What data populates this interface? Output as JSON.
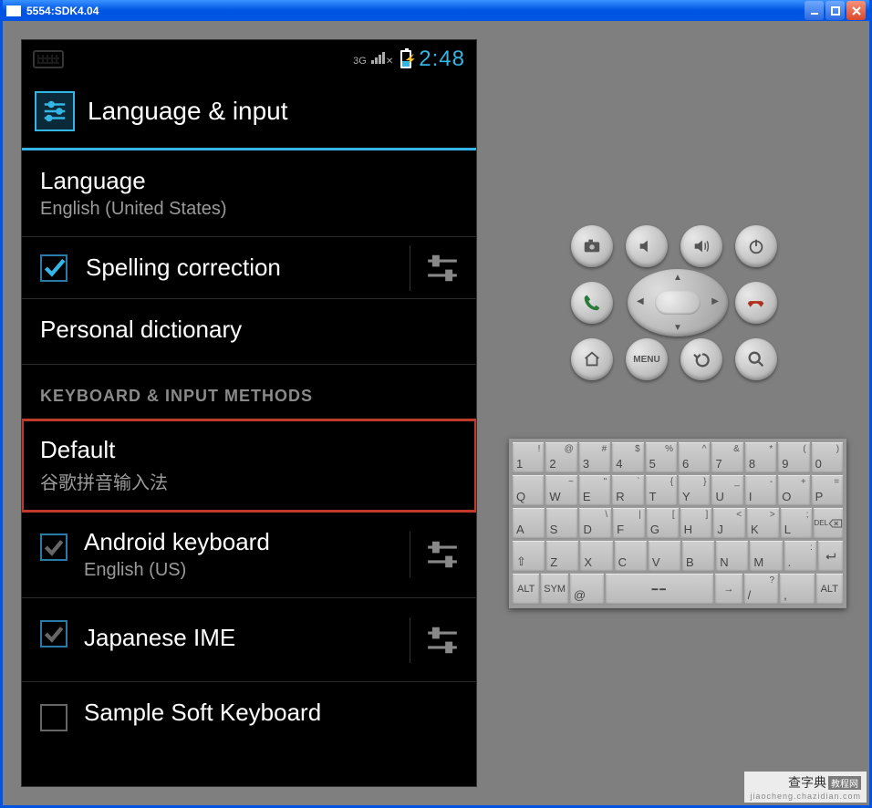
{
  "window": {
    "title": "5554:SDK4.04"
  },
  "statusbar": {
    "signal_label": "3G",
    "time": "2:48"
  },
  "header": {
    "title": "Language & input"
  },
  "rows": {
    "language": {
      "title": "Language",
      "sub": "English (United States)"
    },
    "spelling": {
      "title": "Spelling correction"
    },
    "personal_dict": {
      "title": "Personal dictionary"
    },
    "section_kbd": "KEYBOARD & INPUT METHODS",
    "default": {
      "title": "Default",
      "sub": "谷歌拼音输入法"
    },
    "android_kbd": {
      "title": "Android keyboard",
      "sub": "English (US)"
    },
    "japanese": {
      "title": "Japanese IME"
    },
    "sample": {
      "title": "Sample Soft Keyboard"
    }
  },
  "hw_buttons": {
    "menu": "MENU"
  },
  "kb": {
    "r1": [
      {
        "m": "1",
        "s": "!"
      },
      {
        "m": "2",
        "s": "@"
      },
      {
        "m": "3",
        "s": "#"
      },
      {
        "m": "4",
        "s": "$"
      },
      {
        "m": "5",
        "s": "%"
      },
      {
        "m": "6",
        "s": "^"
      },
      {
        "m": "7",
        "s": "&"
      },
      {
        "m": "8",
        "s": "*"
      },
      {
        "m": "9",
        "s": "("
      },
      {
        "m": "0",
        "s": ")"
      }
    ],
    "r2": [
      {
        "m": "Q",
        "s": ""
      },
      {
        "m": "W",
        "s": "~"
      },
      {
        "m": "E",
        "s": "\""
      },
      {
        "m": "R",
        "s": "`"
      },
      {
        "m": "T",
        "s": "{"
      },
      {
        "m": "Y",
        "s": "}"
      },
      {
        "m": "U",
        "s": "_"
      },
      {
        "m": "I",
        "s": "-"
      },
      {
        "m": "O",
        "s": "+"
      },
      {
        "m": "P",
        "s": "="
      }
    ],
    "r3": [
      {
        "m": "A",
        "s": ""
      },
      {
        "m": "S",
        "s": ""
      },
      {
        "m": "D",
        "s": "\\"
      },
      {
        "m": "F",
        "s": "|"
      },
      {
        "m": "G",
        "s": "["
      },
      {
        "m": "H",
        "s": "]"
      },
      {
        "m": "J",
        "s": "<"
      },
      {
        "m": "K",
        "s": ">"
      },
      {
        "m": "L",
        "s": ";"
      },
      {
        "m": "DEL",
        "s": "",
        "del": true
      }
    ],
    "r4": [
      {
        "m": "⇧",
        "s": ""
      },
      {
        "m": "Z",
        "s": ""
      },
      {
        "m": "X",
        "s": ""
      },
      {
        "m": "C",
        "s": ""
      },
      {
        "m": "V",
        "s": ""
      },
      {
        "m": "B",
        "s": ""
      },
      {
        "m": "N",
        "s": ""
      },
      {
        "m": "M",
        "s": ""
      },
      {
        "m": ".",
        "s": ":"
      },
      {
        "m": "↵",
        "s": "",
        "enter": true
      }
    ],
    "r5": [
      {
        "m": "ALT",
        "w": "ct"
      },
      {
        "m": "SYM",
        "w": "ct"
      },
      {
        "m": "@",
        "w": ""
      },
      {
        "m": "─",
        "w": "w4 ct",
        "space": true
      },
      {
        "m": "→",
        "w": "ct"
      },
      {
        "m": "/",
        "s": "?",
        "w": ""
      },
      {
        "m": ",",
        "s": "",
        "w": ""
      },
      {
        "m": "ALT",
        "w": "ct"
      }
    ]
  },
  "watermark": {
    "main": "查字典",
    "badge": "教程网",
    "url": "jiaocheng.chazidian.com"
  }
}
